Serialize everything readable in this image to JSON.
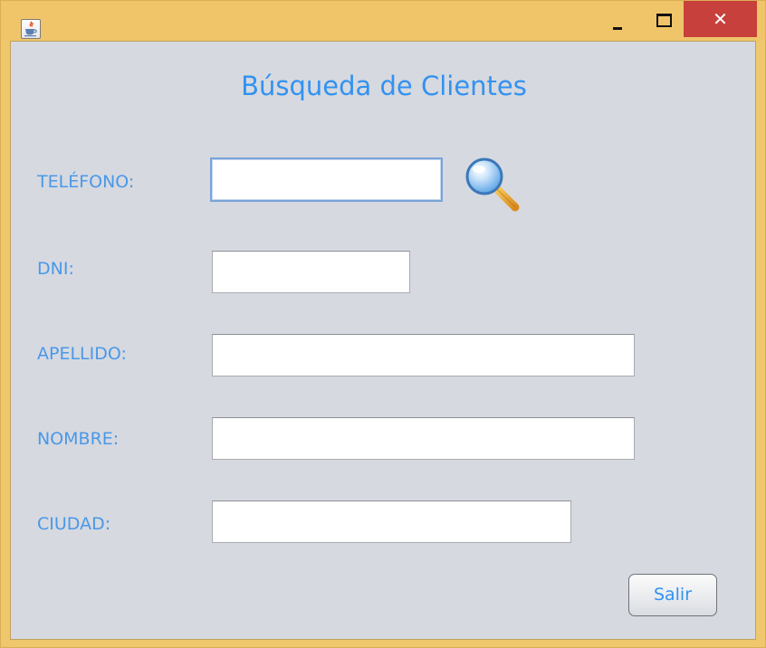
{
  "window": {
    "title_icon": "java-cup-icon",
    "controls": {
      "minimize": "minimize-icon",
      "maximize": "maximize-icon",
      "close_label": "✕"
    },
    "frame_color": "#efc76c",
    "close_color": "#c7403b"
  },
  "form": {
    "title": "Búsqueda de Clientes",
    "accent_color": "#3392f0",
    "fields": {
      "telefono": {
        "label": "TELÉFONO:",
        "value": "",
        "placeholder": ""
      },
      "dni": {
        "label": "DNI:",
        "value": "",
        "placeholder": ""
      },
      "apellido": {
        "label": "APELLIDO:",
        "value": "",
        "placeholder": ""
      },
      "nombre": {
        "label": "NOMBRE:",
        "value": "",
        "placeholder": ""
      },
      "ciudad": {
        "label": "CIUDAD:",
        "value": "",
        "placeholder": ""
      }
    },
    "search_icon": "magnifier-icon",
    "exit_label": "Salir"
  }
}
